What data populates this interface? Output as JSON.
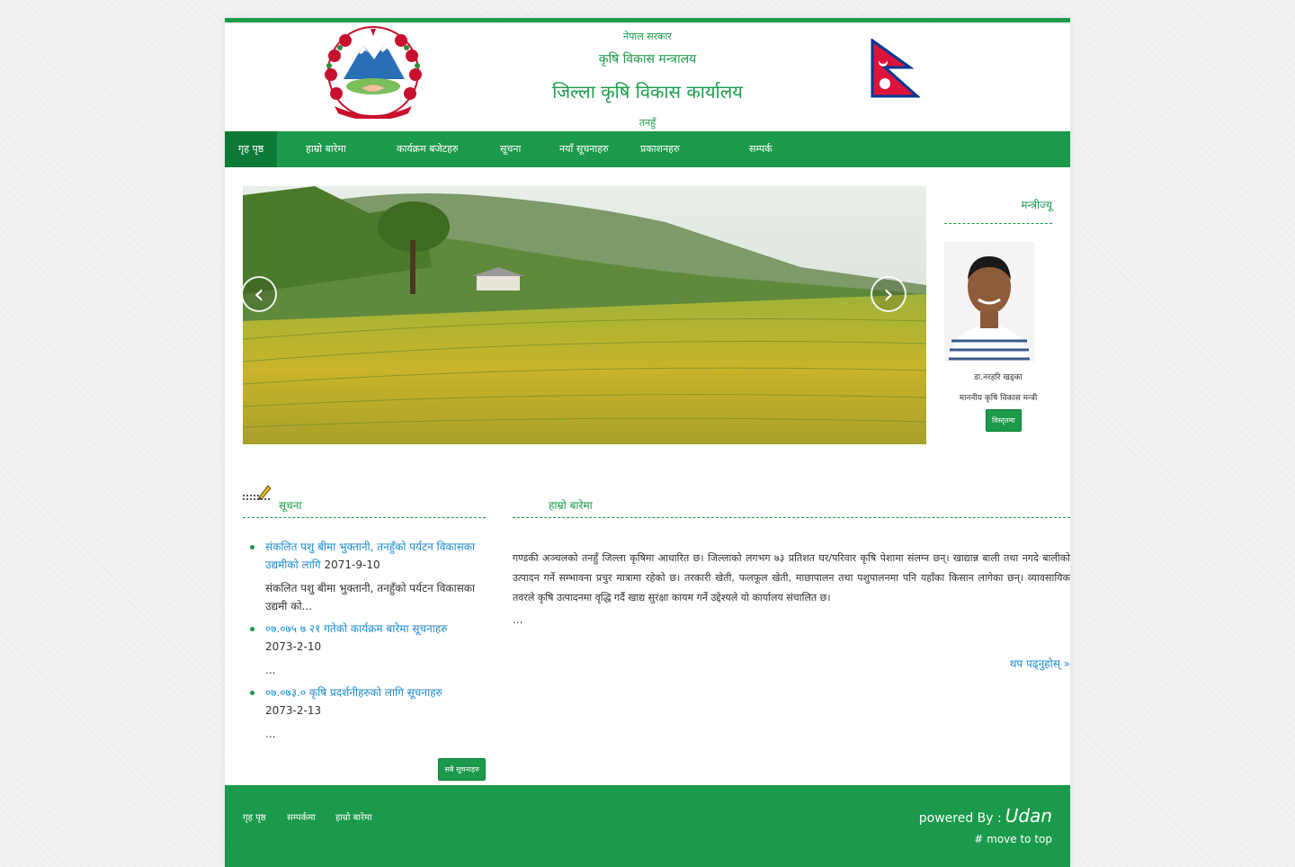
{
  "header": {
    "line1": "नेपाल सरकार",
    "line2": "कृषि विकास मन्त्रालय",
    "line3": "जिल्ला कृषि विकास कार्यालय",
    "line4": "तनहुँ"
  },
  "nav": {
    "items": [
      {
        "label": "गृह पृष्ठ",
        "active": true
      },
      {
        "label": "हाम्रो बारेमा"
      },
      {
        "label": "कार्यक्रम बजेटहरु"
      },
      {
        "label": "सूचना"
      },
      {
        "label": "नयाँ सूचनाहरु"
      },
      {
        "label": "प्रकाशनहरु"
      },
      {
        "label": "सम्पर्क"
      }
    ]
  },
  "slider": {
    "prev": "‹",
    "next": "›"
  },
  "minister": {
    "title": "मन्त्रीज्यू",
    "name": "डा.नरहरि खड्का",
    "role": "माननीय कृषि विकास मन्त्री",
    "button": "विस्तृतमा"
  },
  "notices": {
    "title": "सूचना",
    "items": [
      {
        "link": "संकलित पशु बीमा भुक्तानी, तनहुँको पर्यटन विकासका उद्यमीको लागि",
        "date": "2071-9-10",
        "summary": "संकलित पशु बीमा भुक्तानी, तनहुँको पर्यटन विकासका उद्यमी को..."
      },
      {
        "link": "०७.०७५ ७ २१ गतेको कार्यक्रम बारेमा सूचनाहरु",
        "date": "2073-2-10",
        "summary": "..."
      },
      {
        "link": "०७.०७३.० कृषि प्रदर्शनीहरुको लागि सूचनाहरु",
        "date": "2073-2-13",
        "summary": "..."
      }
    ],
    "button": "सबै सूचनाहरु"
  },
  "intro": {
    "title": "हाम्रो बारेमा",
    "text": "गण्डकी अञ्चलको तनहुँ जिल्ला कृषिमा आधारित छ। जिल्लाको लगभग ७३ प्रतिशत घर/परिवार कृषि पेशामा संलग्न छन्। खाद्यान्न बाली तथा नगदे बालीको उत्पादन गर्ने सम्भावना प्रचुर मात्रामा रहेको छ। तरकारी खेती, फलफूल खेती, माछापालन तथा पशुपालनमा पनि यहाँका किसान लागेका छन्। व्यावसायिक तवरले कृषि उत्पादनमा वृद्धि गर्दै खाद्य सुरक्षा कायम गर्ने उद्देश्यले यो कार्यालय संचालित छ।",
    "ellipsis": "...",
    "more": "थप पढ्नुहोस् »"
  },
  "footer": {
    "links": [
      "गृह पृष्ठ",
      "सम्पर्कमा",
      "हाम्रो बारेमा"
    ],
    "powered_label": "powered By :",
    "powered_brand": "Udan",
    "move_top": "# move to top"
  },
  "colors": {
    "accent": "#1a9a4a",
    "accent_dark": "#0c7a36",
    "link": "#1a8ad0"
  }
}
